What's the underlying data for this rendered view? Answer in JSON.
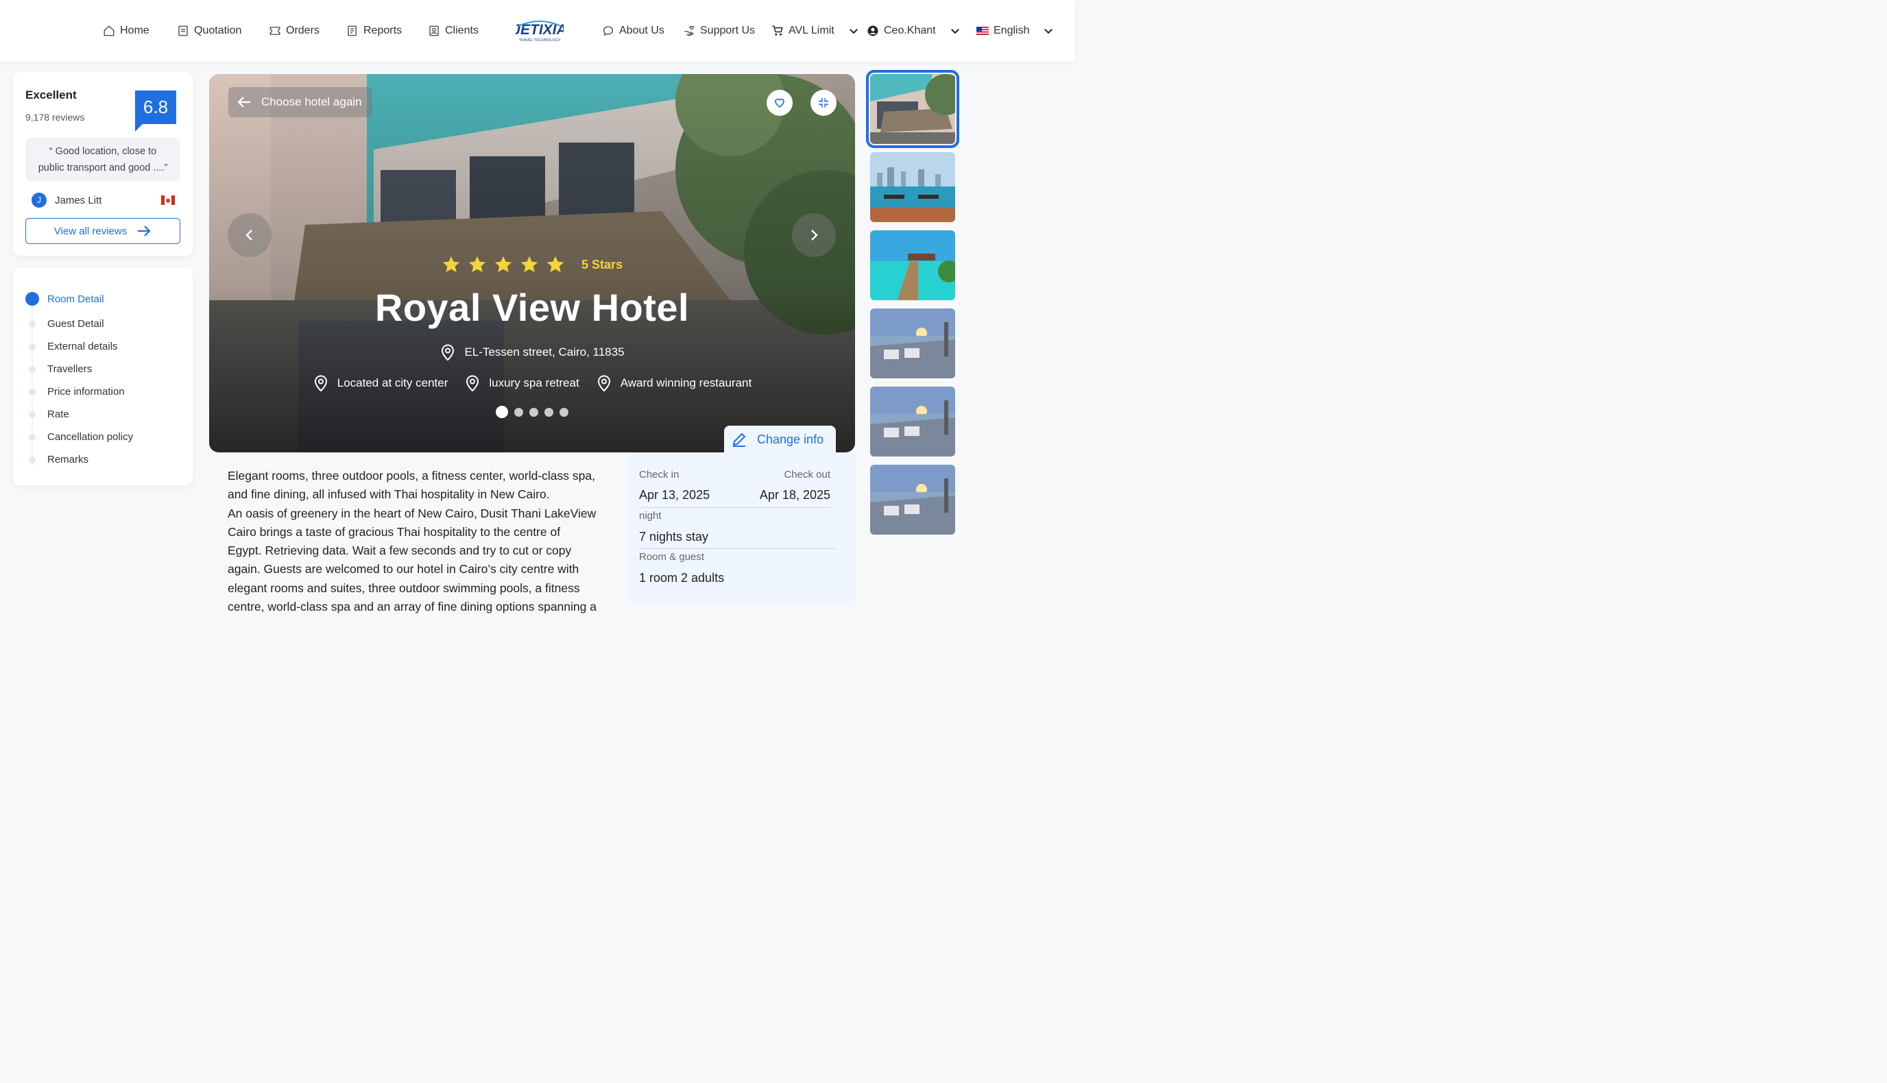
{
  "nav": {
    "left": [
      {
        "label": "Home",
        "icon": "home-icon"
      },
      {
        "label": "Quotation",
        "icon": "document-icon"
      },
      {
        "label": "Orders",
        "icon": "ticket-icon"
      },
      {
        "label": "Reports",
        "icon": "report-icon"
      },
      {
        "label": "Clients",
        "icon": "client-card-icon"
      }
    ],
    "logo_text": "JETIXIA",
    "logo_tagline": "TRAVEL TECHNOLOGY",
    "about": "About Us",
    "support": "Support Us",
    "limit": "AVL Limit",
    "user": "Ceo.Khant",
    "language": "English"
  },
  "review": {
    "rating_word": "Excellent",
    "count": "9,178 reviews",
    "score": "6.8",
    "quote_line1": "“ Good location, close to",
    "quote_line2": "public transport and good ....”",
    "reviewer_initial": "J",
    "reviewer_name": "James Litt",
    "view_all": "View all reviews"
  },
  "steps": [
    {
      "label": "Room Detail",
      "active": true
    },
    {
      "label": "Guest Detail",
      "active": false
    },
    {
      "label": "External details",
      "active": false
    },
    {
      "label": "Travellers",
      "active": false
    },
    {
      "label": "Price information",
      "active": false
    },
    {
      "label": "Rate",
      "active": false
    },
    {
      "label": "Cancellation policy",
      "active": false
    },
    {
      "label": "Remarks",
      "active": false
    }
  ],
  "hero": {
    "back": "Choose hotel again",
    "stars": 5,
    "stars_label": "5 Stars",
    "name": "Royal View Hotel",
    "address": "EL-Tessen street, Cairo, 11835",
    "features": [
      "Located at city center",
      "luxury spa retreat",
      "Award winning restaurant"
    ],
    "slide_count": 5,
    "active_slide": 1
  },
  "booking": {
    "change_info": "Change info",
    "checkin_label": "Check in",
    "checkin": "Apr 13, 2025",
    "checkout_label": "Check out",
    "checkout": "Apr 18, 2025",
    "night_label": "night",
    "nights": "7 nights stay",
    "room_label": "Room & guest",
    "room": "1 room 2 adults"
  },
  "description": [
    "Elegant rooms, three outdoor pools, a fitness center, world-class spa,",
    "and fine dining, all infused with Thai hospitality in New Cairo.",
    "An oasis of greenery in the heart of New Cairo, Dusit Thani LakeView",
    "Cairo brings a taste of gracious Thai hospitality to the centre of",
    "Egypt. Retrieving data. Wait a few seconds and try to cut or copy",
    "again. Guests are welcomed to our hotel in Cairo’s city centre with",
    "elegant rooms and suites, three outdoor swimming pools, a fitness",
    "centre, world-class spa and an array of fine dining options spanning a"
  ],
  "colors": {
    "accent": "#1f6fe0",
    "star": "#f5d33a",
    "panel": "#f0f6ff"
  },
  "thumbnails": [
    "hotel-facade",
    "city-pool",
    "overwater-villas",
    "sunset-deck",
    "sunset-deck",
    "sunset-deck"
  ]
}
